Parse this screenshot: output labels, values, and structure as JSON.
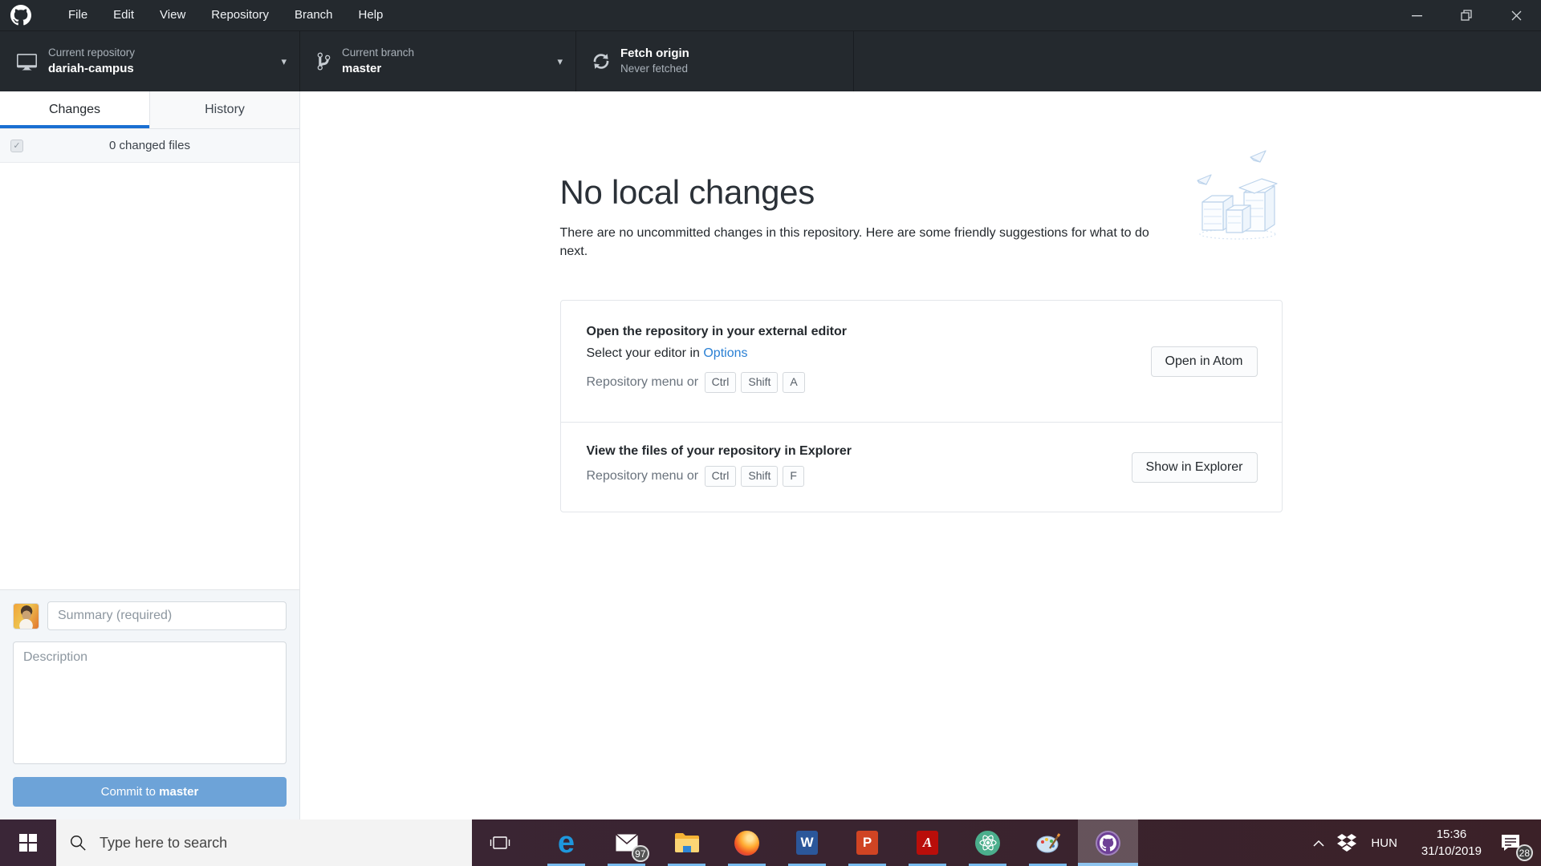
{
  "colors": {
    "titlebar": "#24292e",
    "toolbar": "#24292e",
    "divider_dark": "#191d21",
    "tab_accent": "#1a6fd2",
    "link": "#2a80d4",
    "commit_button": "#6da3d8",
    "taskbar_left": "#3a2637",
    "taskbar_right": "#3b2128",
    "app_underline": "#76b9ed",
    "github_purple": "#6e4096"
  },
  "titlebar": {
    "menu": [
      "File",
      "Edit",
      "View",
      "Repository",
      "Branch",
      "Help"
    ]
  },
  "toolbar": {
    "repository_label": "Current repository",
    "repository_value": "dariah-campus",
    "branch_label": "Current branch",
    "branch_value": "master",
    "fetch_label": "Fetch origin",
    "fetch_status": "Never fetched"
  },
  "sidebar": {
    "tab_changes": "Changes",
    "tab_history": "History",
    "changed_files": "0 changed files",
    "checkbox_glyph": "✓",
    "summary_placeholder": "Summary (required)",
    "description_placeholder": "Description",
    "commit_prefix": "Commit to ",
    "commit_branch": "master"
  },
  "main": {
    "title": "No local changes",
    "subtitle": "There are no uncommitted changes in this repository. Here are some friendly suggestions for what to do next.",
    "card1": {
      "title": "Open the repository in your external editor",
      "line2_prefix": "Select your editor in ",
      "link": "Options",
      "shortcut_prefix": "Repository menu or",
      "keys": [
        "Ctrl",
        "Shift",
        "A"
      ],
      "button": "Open in Atom"
    },
    "card2": {
      "title": "View the files of your repository in Explorer",
      "shortcut_prefix": "Repository menu or",
      "keys": [
        "Ctrl",
        "Shift",
        "F"
      ],
      "button": "Show in Explorer"
    }
  },
  "taskbar": {
    "search_placeholder": "Type here to search",
    "mail_badge": "97",
    "word_letter": "W",
    "ppt_letter": "P",
    "pdf_letter": "A",
    "edge_letter": "e",
    "tray": {
      "language": "HUN",
      "time": "15:36",
      "date": "31/10/2019",
      "notifications_badge": "28"
    }
  }
}
